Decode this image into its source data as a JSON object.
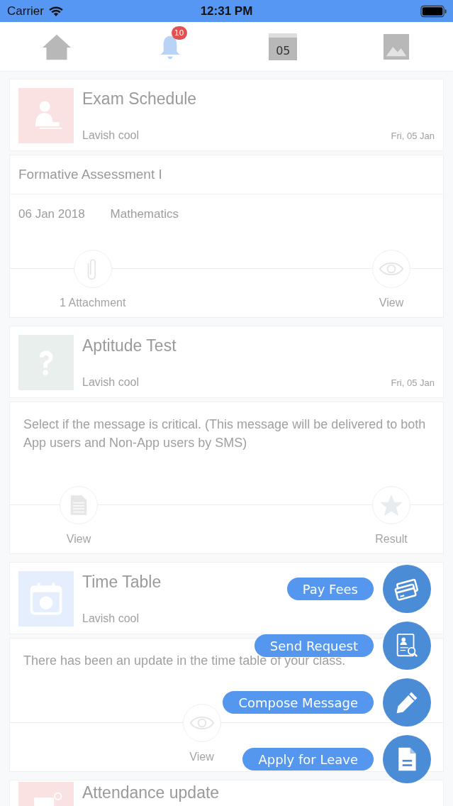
{
  "status_bar": {
    "carrier": "Carrier",
    "time": "12:31 PM"
  },
  "nav": [
    {
      "kind": "home",
      "selected": false
    },
    {
      "kind": "bell",
      "selected": true,
      "badge": "10"
    },
    {
      "kind": "calendar",
      "selected": false,
      "text": "05"
    },
    {
      "kind": "picture",
      "selected": false
    }
  ],
  "feed": [
    {
      "title": "Exam Schedule",
      "author": "Lavish cool",
      "date": "Fri, 05 Jan",
      "kind": "person",
      "color": "#fbe2e2",
      "detail": {
        "heading": "Formative Assessment I",
        "date": "06 Jan 2018",
        "subject": "Mathematics",
        "actions": [
          {
            "kind": "attachment",
            "label": "1 Attachment"
          },
          {
            "kind": "eye",
            "label": "View"
          }
        ]
      }
    },
    {
      "title": "Aptitude Test",
      "author": "Lavish cool",
      "date": "Fri, 05 Jan",
      "kind": "question",
      "color": "#e9efed",
      "detail": {
        "message": "Select if the message is critical. (This message will be delivered to both App users and Non-App users by SMS)",
        "actions": [
          {
            "kind": "document",
            "label": "View"
          },
          {
            "kind": "star",
            "label": "Result"
          }
        ]
      }
    },
    {
      "title": "Time Table",
      "author": "Lavish cool",
      "kind": "calendar",
      "color": "#e4eefc",
      "detail": {
        "message": "There has been an update in the time table of your class.",
        "actions": [
          {
            "kind": "eye",
            "label": "View"
          }
        ]
      }
    },
    {
      "title": "Attendance update",
      "kind": "attendance",
      "color": "#fbe2e2"
    }
  ],
  "fab_menu": [
    {
      "label": "Pay Fees",
      "kind": "cards"
    },
    {
      "label": "Send Request",
      "kind": "request"
    },
    {
      "label": "Compose Message",
      "kind": "pencil"
    },
    {
      "label": "Apply for Leave",
      "kind": "document"
    }
  ]
}
